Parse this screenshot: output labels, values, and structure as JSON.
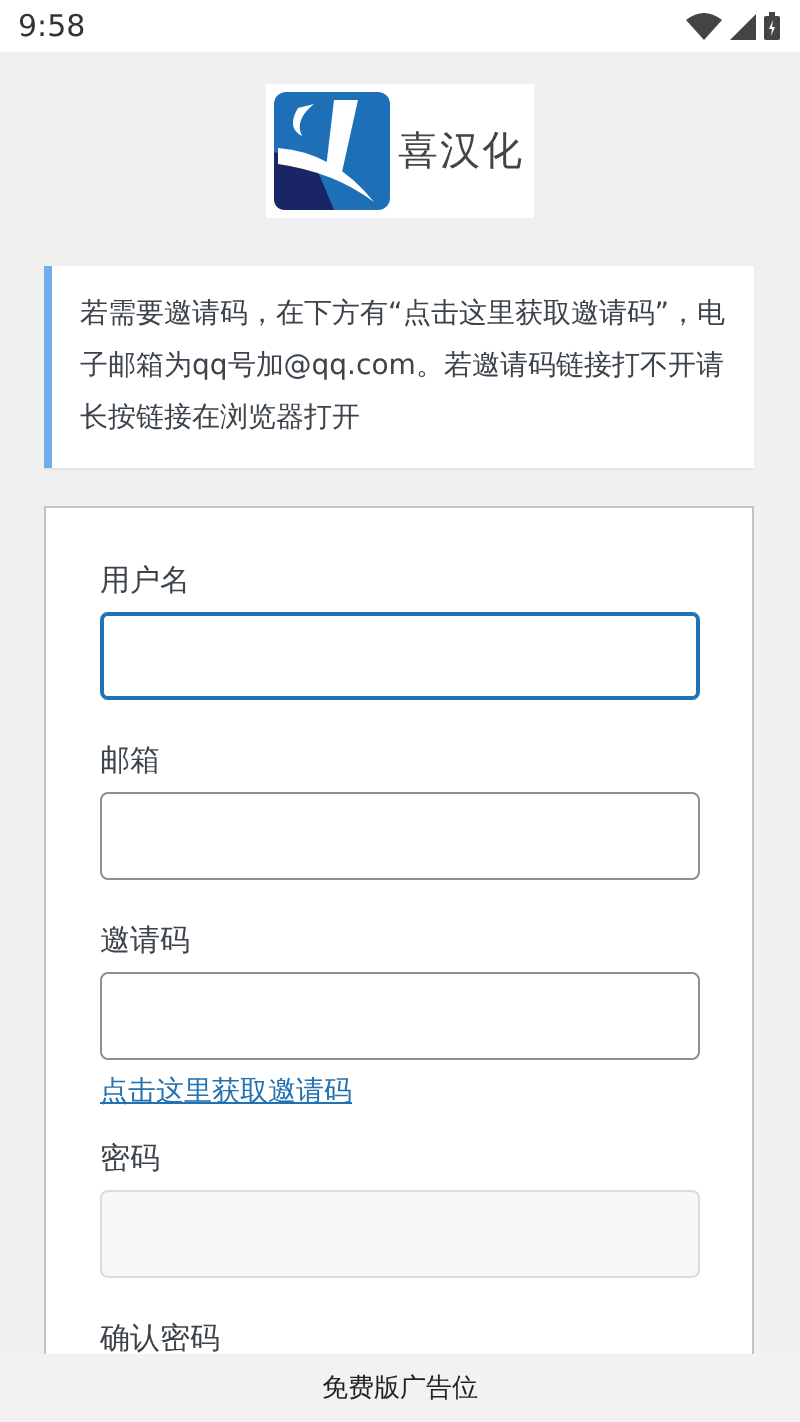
{
  "status_bar": {
    "time": "9:58"
  },
  "logo": {
    "text": "喜汉化"
  },
  "notice": {
    "text": "若需要邀请码，在下方有“点击这里获取邀请码”，电子邮箱为qq号加@qq.com。若邀请码链接打不开请长按链接在浏览器打开"
  },
  "form": {
    "fields": [
      {
        "label": "用户名",
        "focused": true,
        "disabled": false
      },
      {
        "label": "邮箱",
        "focused": false,
        "disabled": false
      },
      {
        "label": "邀请码",
        "focused": false,
        "disabled": false,
        "link": "点击这里获取邀请码"
      },
      {
        "label": "密码",
        "focused": false,
        "disabled": true
      },
      {
        "label": "确认密码"
      }
    ]
  },
  "ad_bar": {
    "text": "免费版广告位"
  }
}
